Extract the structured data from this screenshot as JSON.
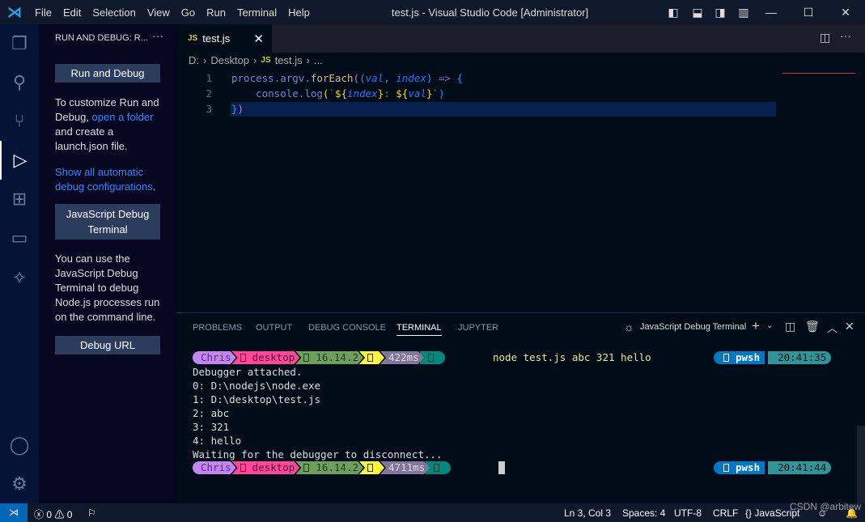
{
  "titlebar": {
    "menu": [
      "File",
      "Edit",
      "Selection",
      "View",
      "Go",
      "Run",
      "Terminal",
      "Help"
    ],
    "title": "test.js - Visual Studio Code [Administrator]"
  },
  "sidebar": {
    "header": "RUN AND DEBUG: R...",
    "run_debug_label": "Run and Debug",
    "customize_pre": "To customize Run and Debug, ",
    "open_folder_link": "open a folder",
    "customize_post": " and create a launch.json file.",
    "show_all_link": "Show all automatic debug configurations",
    "show_all_post": ".",
    "js_debug_terminal_label": "JavaScript Debug Terminal",
    "js_debug_text": "You can use the JavaScript Debug Terminal to debug Node.js processes run on the command line.",
    "debug_url_label": "Debug URL"
  },
  "editor": {
    "tab_label": "test.js",
    "file_badge": "JS",
    "breadcrumbs": [
      "D:",
      "Desktop",
      "test.js",
      "..."
    ],
    "line_numbers": [
      "1",
      "2",
      "3"
    ],
    "lines": [
      [
        {
          "t": "process",
          "c": "#6688cc"
        },
        {
          "t": ".",
          "c": "#6688cc"
        },
        {
          "t": "argv",
          "c": "#6688cc"
        },
        {
          "t": ".",
          "c": "#6688cc"
        },
        {
          "t": "forEach",
          "c": "#ddbb88"
        },
        {
          "t": "(",
          "c": "#da70d6"
        },
        {
          "t": "(",
          "c": "#179fff"
        },
        {
          "t": "val",
          "c": "#2277ff",
          "i": true
        },
        {
          "t": ", ",
          "c": "#6688cc"
        },
        {
          "t": "index",
          "c": "#2277ff",
          "i": true
        },
        {
          "t": ")",
          "c": "#179fff"
        },
        {
          "t": " => ",
          "c": "#9966b8"
        },
        {
          "t": "{",
          "c": "#179fff"
        }
      ],
      [
        {
          "t": "    console",
          "c": "#6688cc"
        },
        {
          "t": ".",
          "c": "#6688cc"
        },
        {
          "t": "log",
          "c": "#6688cc"
        },
        {
          "t": "(",
          "c": "#ffd700"
        },
        {
          "t": "`",
          "c": "#22aa44"
        },
        {
          "t": "${",
          "c": "#ffd700"
        },
        {
          "t": "index",
          "c": "#2277ff",
          "i": true
        },
        {
          "t": "}",
          "c": "#ffd700"
        },
        {
          "t": ": ",
          "c": "#22aa44"
        },
        {
          "t": "${",
          "c": "#ffd700"
        },
        {
          "t": "val",
          "c": "#2277ff",
          "i": true
        },
        {
          "t": "}",
          "c": "#ffd700"
        },
        {
          "t": "`",
          "c": "#22aa44"
        },
        {
          "t": ")",
          "c": "#179fff"
        }
      ],
      [
        {
          "t": "}",
          "c": "#179fff"
        },
        {
          "t": ")",
          "c": "#da70d6"
        }
      ]
    ]
  },
  "panel": {
    "tabs": [
      "PROBLEMS",
      "OUTPUT",
      "DEBUG CONSOLE",
      "TERMINAL",
      "JUPYTER"
    ],
    "active_tab": "TERMINAL",
    "terminal_name": "JavaScript Debug Terminal",
    "prompt1": [
      {
        "t": "Chris",
        "bg": "#c386f1",
        "fg": "#5a2f7a"
      },
      {
        "t": "desktop",
        "bg": "#ff479c",
        "fg": "#5a0a30",
        "icon": "folder-icon"
      },
      {
        "t": "16.14.2",
        "bg": "#6e9f5e",
        "fg": "#1f3a17",
        "icon": "node-icon"
      },
      {
        "t": "",
        "bg": "#fffb38",
        "fg": "#333",
        "icon": "git-icon"
      },
      {
        "t": "422ms",
        "bg": "#83769c",
        "fg": "#ddd"
      },
      {
        "t": "",
        "bg": "#00897b",
        "fg": "#00332d",
        "icon": "status-icon"
      }
    ],
    "command": "node test.js abc 321 hello",
    "output": [
      "Debugger attached.",
      "0: D:\\nodejs\\node.exe",
      "1: D:\\desktop\\test.js",
      "2: abc",
      "3: 321",
      "4: hello",
      "Waiting for the debugger to disconnect..."
    ],
    "prompt2": [
      {
        "t": "Chris",
        "bg": "#c386f1",
        "fg": "#5a2f7a"
      },
      {
        "t": "desktop",
        "bg": "#ff479c",
        "fg": "#5a0a30",
        "icon": "folder-icon"
      },
      {
        "t": "16.14.2",
        "bg": "#6e9f5e",
        "fg": "#1f3a17",
        "icon": "node-icon"
      },
      {
        "t": "",
        "bg": "#fffb38",
        "fg": "#333",
        "icon": "git-icon"
      },
      {
        "t": "4711ms",
        "bg": "#83769c",
        "fg": "#ddd"
      },
      {
        "t": "",
        "bg": "#00897b",
        "fg": "#00332d",
        "icon": "status-icon"
      }
    ],
    "rprompt1": {
      "shell": "pwsh",
      "time": "20:41:35"
    },
    "rprompt2": {
      "shell": "pwsh",
      "time": "20:41:44"
    }
  },
  "statusbar": {
    "errors": "0",
    "warnings": "0",
    "position": "Ln 3, Col 3",
    "spaces": "Spaces: 4",
    "encoding": "UTF-8",
    "eol": "CRLF",
    "language": "JavaScript",
    "watermark": "CSDN @arbitew"
  }
}
